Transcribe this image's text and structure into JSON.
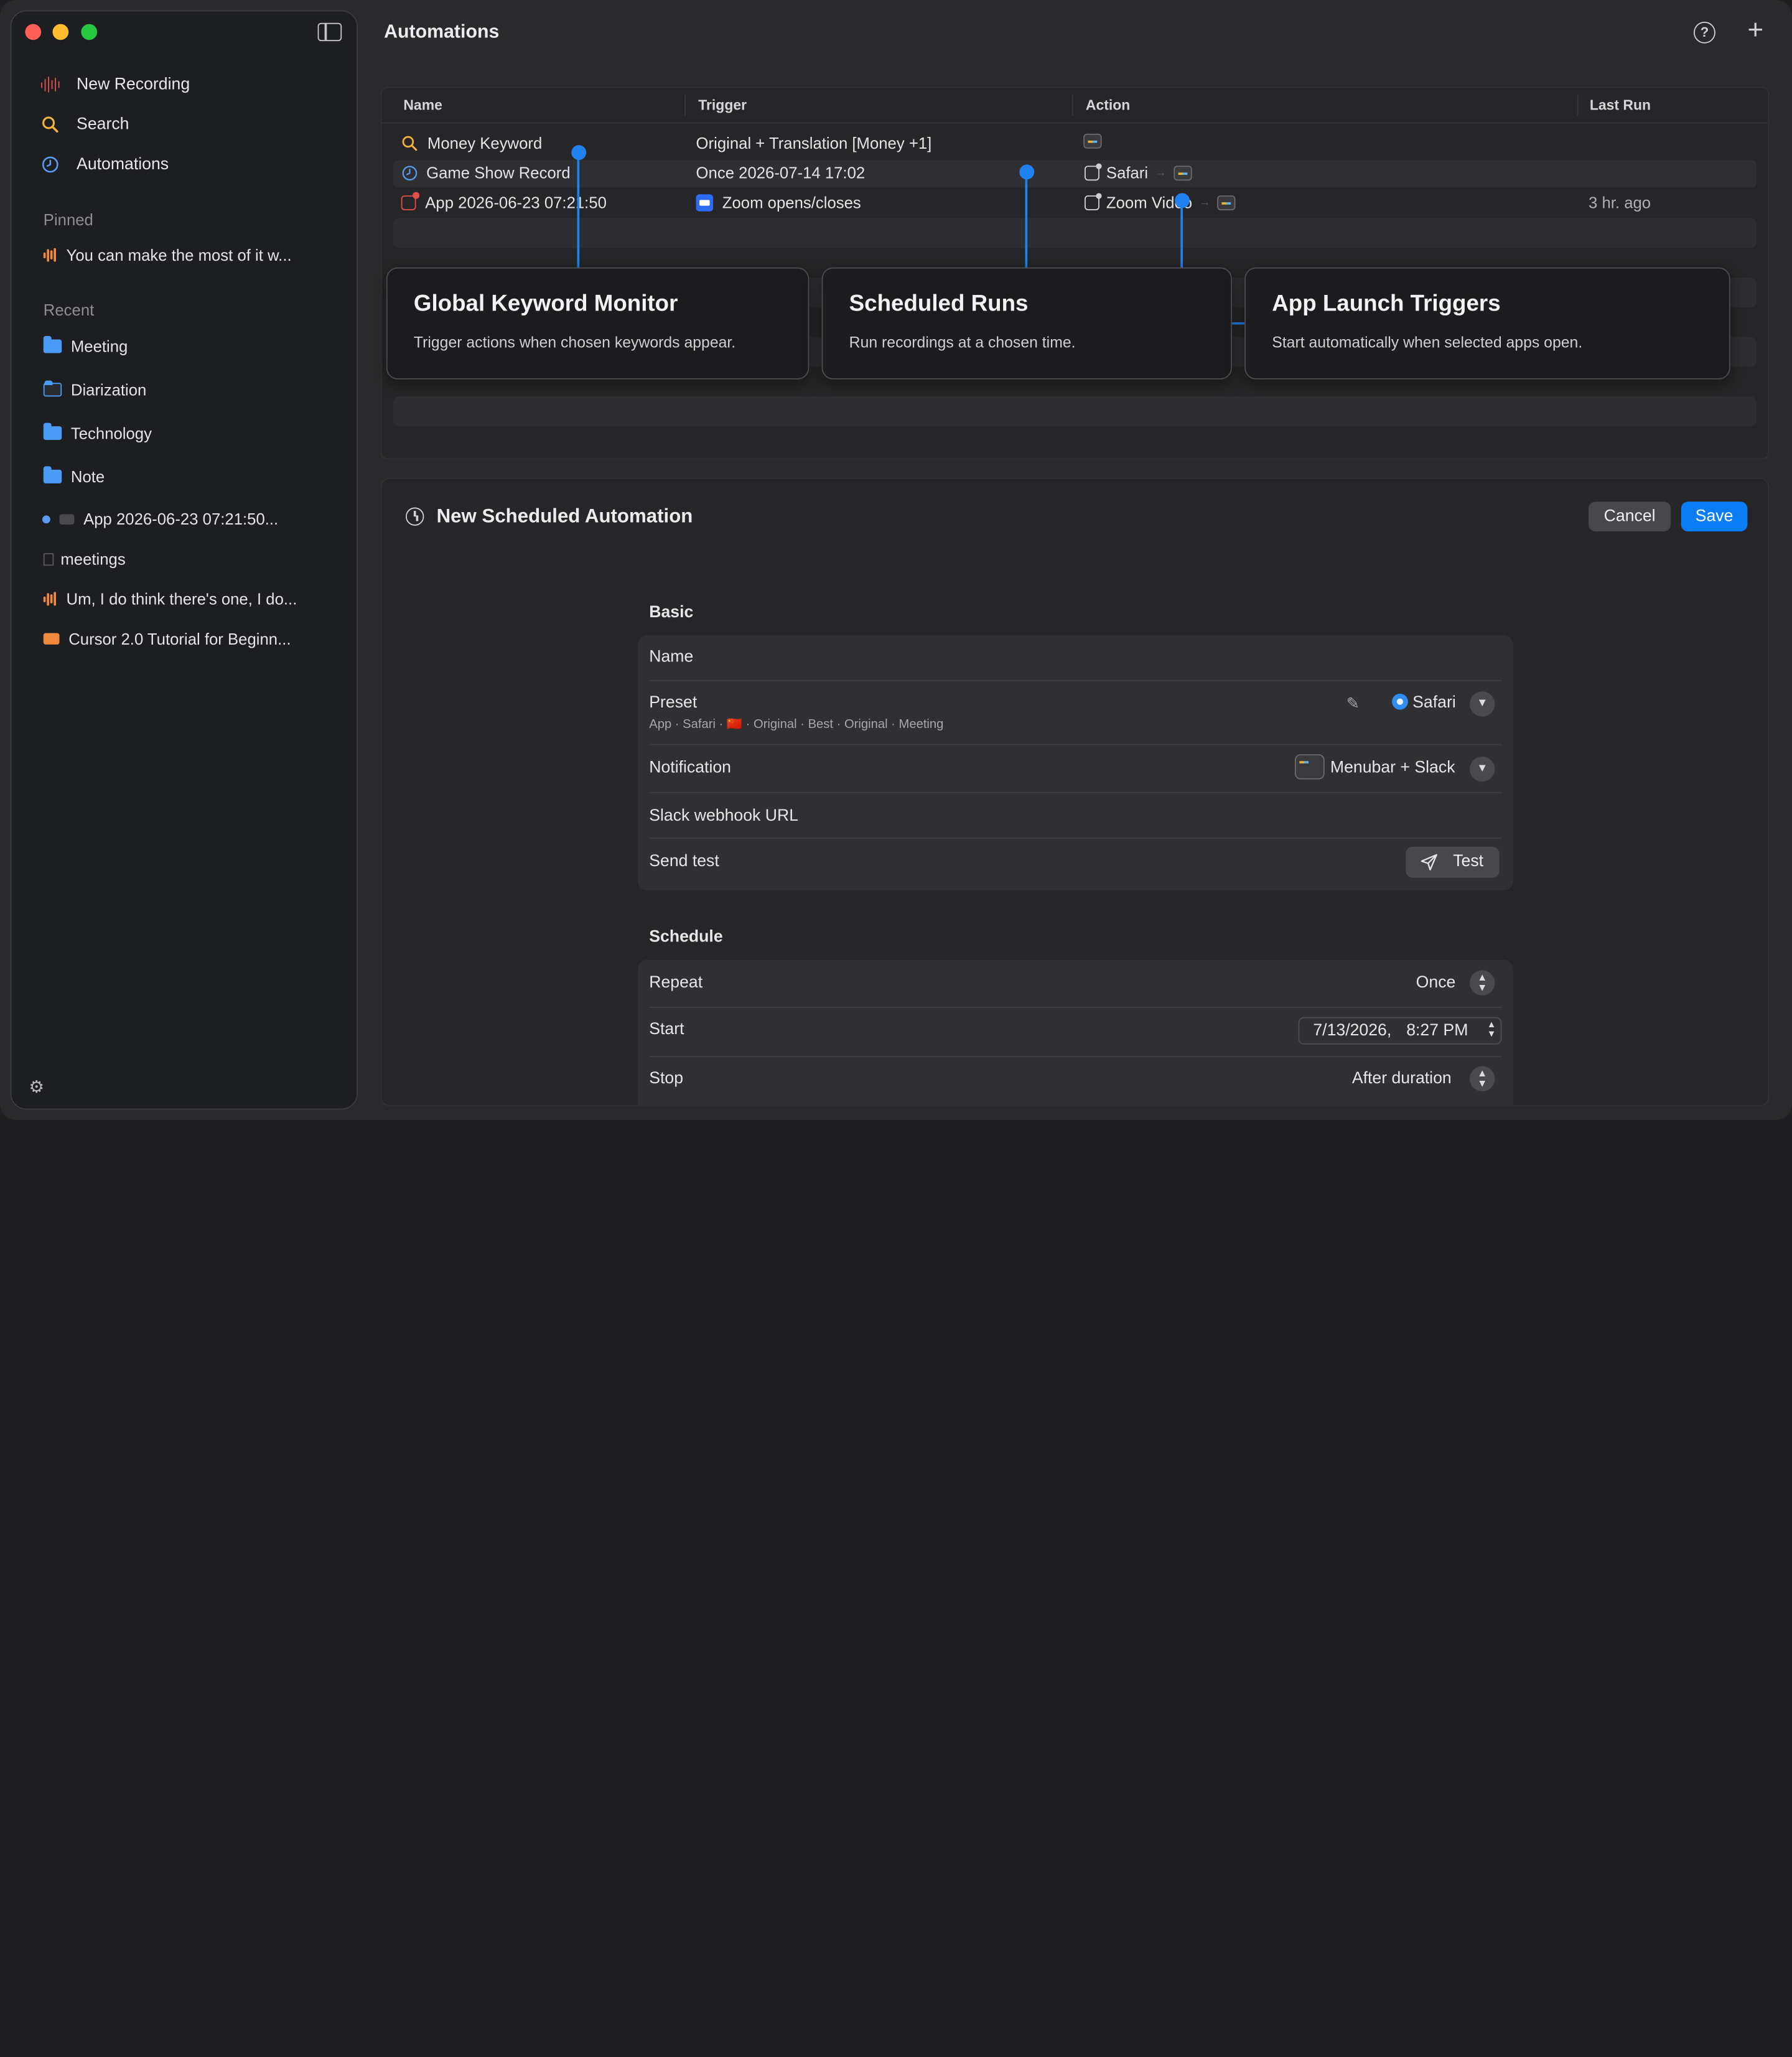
{
  "window": {
    "title": "Automations"
  },
  "sidebar": {
    "nav": [
      {
        "label": "New Recording",
        "icon": "waveform-icon"
      },
      {
        "label": "Search",
        "icon": "search-icon"
      },
      {
        "label": "Automations",
        "icon": "clock-icon"
      }
    ],
    "pinned_label": "Pinned",
    "pinned": [
      {
        "label": "You can make the most of it w...",
        "icon": "waveform-icon"
      }
    ],
    "recent_label": "Recent",
    "recent": [
      {
        "label": "Meeting",
        "icon": "folder-icon"
      },
      {
        "label": "Diarization",
        "icon": "folder-icon"
      },
      {
        "label": "Technology",
        "icon": "folder-icon"
      },
      {
        "label": "Note",
        "icon": "folder-icon"
      },
      {
        "label": "App 2026-06-23 07:21:50...",
        "icon": "camera-icon"
      },
      {
        "label": "meetings",
        "icon": "document-icon"
      },
      {
        "label": "Um, I do think there's one, I do...",
        "icon": "waveform-icon"
      },
      {
        "label": "Cursor 2.0 Tutorial for Beginn...",
        "icon": "video-icon"
      }
    ]
  },
  "table": {
    "columns": [
      "Name",
      "Trigger",
      "Action",
      "Last Run"
    ],
    "rows": [
      {
        "name": "Money Keyword",
        "trigger": "Original + Translation [Money +1]",
        "action": "",
        "last_run": ""
      },
      {
        "name": "Game Show Record",
        "trigger": "Once 2026-07-14 17:02",
        "action": "Safari",
        "last_run": ""
      },
      {
        "name": "App 2026-06-23 07:21:50",
        "trigger": "Zoom opens/closes",
        "action": "Zoom Video",
        "last_run": "3 hr. ago"
      }
    ]
  },
  "callouts": [
    {
      "title": "Global Keyword Monitor",
      "text": "Trigger actions when chosen keywords appear."
    },
    {
      "title": "Scheduled Runs",
      "text": "Run recordings at a chosen time."
    },
    {
      "title": "App Launch Triggers",
      "text": "Start automatically when selected apps open."
    }
  ],
  "form": {
    "title": "New Scheduled Automation",
    "cancel": "Cancel",
    "save": "Save",
    "basic_label": "Basic",
    "name_label": "Name",
    "preset_label": "Preset",
    "preset_sub": "App · Safari · 🇨🇳 · Original · Best · Original · Meeting",
    "preset_value": "Safari",
    "notification_label": "Notification",
    "notification_value": "Menubar + Slack",
    "webhook_label": "Slack webhook URL",
    "sendtest_label": "Send test",
    "test_button": "Test",
    "schedule_label": "Schedule",
    "repeat_label": "Repeat",
    "repeat_value": "Once",
    "start_label": "Start",
    "start_date": "7/13/2026,",
    "start_time": "8:27 PM",
    "stop_label": "Stop",
    "stop_value": "After duration"
  },
  "colors": {
    "accent": "#0a7df5",
    "callout_line": "#1f82f0",
    "orange": "#f08a3c",
    "folder": "#4a9bf5"
  }
}
